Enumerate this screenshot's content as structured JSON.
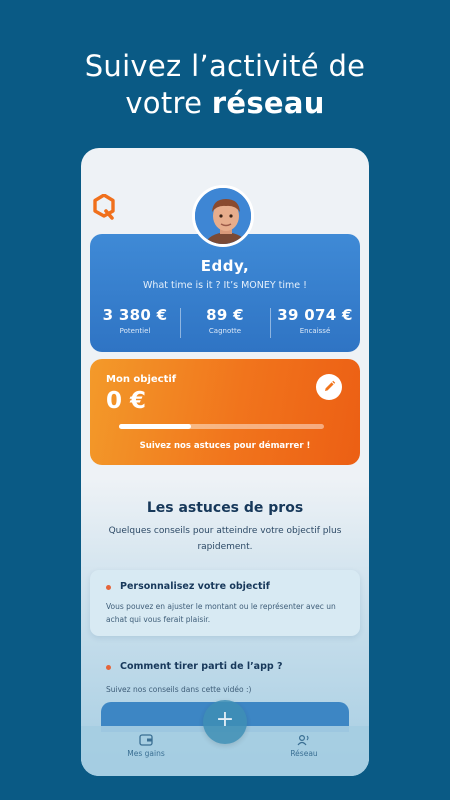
{
  "headline": {
    "line1": "Suivez l’activité de",
    "line2_prefix": "votre ",
    "line2_bold": "réseau"
  },
  "profile": {
    "name": "Eddy,",
    "tagline": "What time is it ? It’s MONEY time !"
  },
  "stats": [
    {
      "value": "3 380 €",
      "label": "Potentiel"
    },
    {
      "value": "89 €",
      "label": "Cagnotte"
    },
    {
      "value": "39 074 €",
      "label": "Encaissé"
    }
  ],
  "goal": {
    "title": "Mon objectif",
    "amount": "0 €",
    "progress_fraction": 0.35,
    "hint": "Suivez nos astuces pour démarrer !"
  },
  "tips": {
    "title": "Les astuces de pros",
    "subtitle": "Quelques conseils pour atteindre votre objectif plus rapidement.",
    "items": [
      {
        "title": "Personnalisez votre objectif",
        "text": "Vous pouvez en ajuster le montant ou le représenter avec un achat qui vous ferait plaisir."
      },
      {
        "title": "Comment tirer parti de l’app ?",
        "text": "Suivez nos conseils dans cette vidéo :)"
      }
    ]
  },
  "nav": {
    "left_label": "Mes gains",
    "right_label": "Réseau",
    "fab_label": "+"
  },
  "colors": {
    "background": "#0a5a85",
    "stats_card": "#3f8ad6",
    "goal_card": "#f1741c",
    "accent_dot": "#e5653a"
  },
  "icons": [
    "logo-icon",
    "edit-pencil-icon",
    "wallet-icon",
    "network-icon",
    "plus-icon"
  ]
}
